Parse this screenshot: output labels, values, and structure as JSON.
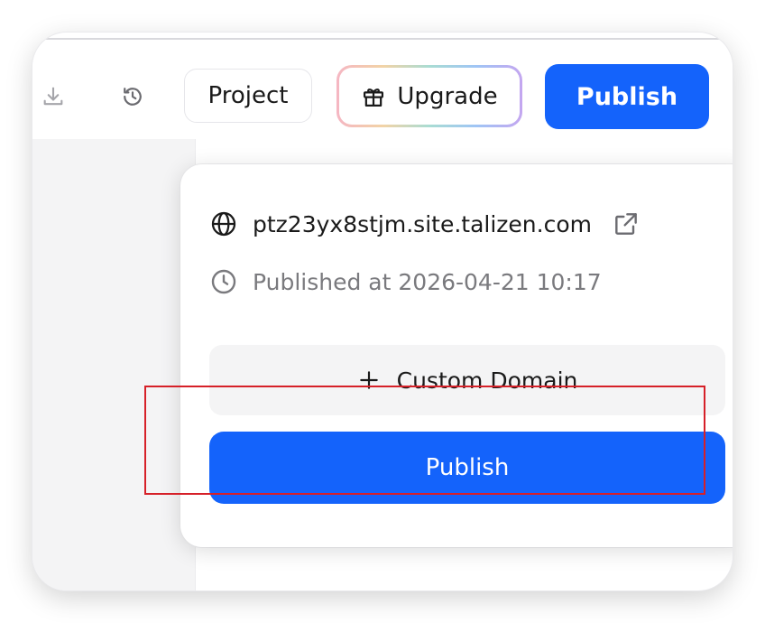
{
  "toolbar": {
    "download_icon": "download-icon",
    "history_icon": "history-icon",
    "project_label": "Project",
    "upgrade_label": "Upgrade",
    "upgrade_icon": "gift-icon",
    "publish_label": "Publish"
  },
  "publish_popover": {
    "site_url": "ptz23yx8stjm.site.talizen.com",
    "url_icon": "globe-icon",
    "open_icon": "external-link-icon",
    "published_at": "Published at 2026-04-21 10:17",
    "time_icon": "clock-icon",
    "custom_domain_label": "Custom Domain",
    "custom_domain_icon": "plus-icon",
    "publish_label": "Publish"
  },
  "colors": {
    "accent": "#1463fb",
    "highlight": "#d62028",
    "muted_text": "#7a7a7e"
  }
}
